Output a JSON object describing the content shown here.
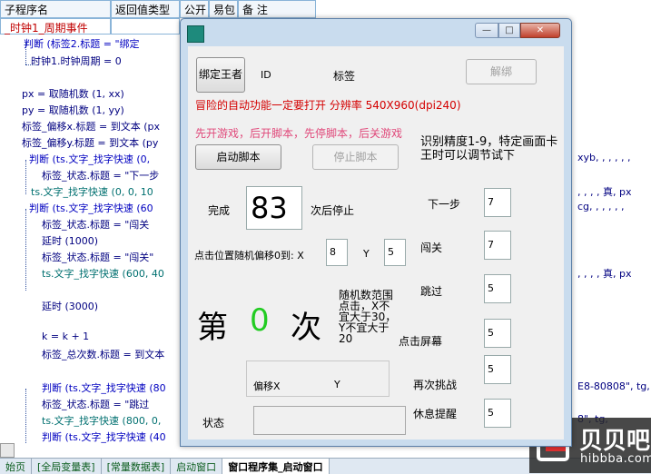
{
  "editor": {
    "headers": [
      "子程序名",
      "返回值类型",
      "公开",
      "易包",
      "备 注"
    ],
    "subroutine_name": "_时钟1_周期事件",
    "lines": [
      "判断 (标签2.标题 = \"绑定",
      "时钟1.时钟周期 = 0",
      "px = 取随机数 (1, xx)",
      "py = 取随机数 (1, yy)",
      "标签_偏移x.标题 = 到文本 (px",
      "标签_偏移y.标题 = 到文本 (py",
      "判断 (ts.文字_找字快速 (0,",
      "标签_状态.标题 = \"下一步",
      "ts.文字_找字快速 (0, 0, 10",
      "判断 (ts.文字_找字快速 (60",
      "标签_状态.标题 = \"闯关",
      "延时 (1000)",
      "标签_状态.标题 = \"闯关\"",
      "ts.文字_找字快速 (600, 40",
      "延时 (3000)",
      "k = k + 1",
      "标签_总次数.标题 = 到文本",
      "判断 (ts.文字_找字快速 (80",
      "标签_状态.标题 = \"跳过",
      "ts.文字_找字快速 (800, 0,",
      "判断 (ts.文字_找字快速 (40"
    ],
    "right_fragments": [
      "xyb, , , , , ,",
      ", , , , 真, px",
      "cg, , , , , ,",
      ", , , , 真, px",
      "E8-80808\", tg,",
      "8\", tg,"
    ],
    "tabs": [
      "始页",
      "[全局变量表]",
      "[常量数据表]",
      "启动窗口",
      "窗口程序集_启动窗口"
    ]
  },
  "watermark": {
    "brand": "贝贝吧",
    "url": "hibbba.com"
  },
  "window": {
    "controls": {
      "min": "—",
      "max": "□",
      "close": "✕"
    },
    "bind_button": "绑定王者",
    "id_label": "ID",
    "tag_label": "标签",
    "unbind_button": "解绑",
    "warning": "冒险的自动功能一定要打开 分辨率 540X960(dpi240)",
    "hint": "先开游戏，后开脚本，先停脚本，后关游戏",
    "precision_text": "识别精度1-9，特定画面卡王时可以调节试下",
    "start_button": "启动脚本",
    "stop_button": "停止脚本",
    "complete_label": "完成",
    "complete_count": "83",
    "stop_after": "次后停止",
    "offset_label": "点击位置随机偏移0到: X",
    "offset_x": "8",
    "y_label": "Y",
    "offset_y": "5",
    "counter_prefix": "第",
    "counter_value": "0",
    "counter_suffix": "次",
    "random_note": "随机数范围点击，X不宜大于30，Y不宜大于20",
    "click_screen": "点击屏幕",
    "offset_x_label": "偏移X",
    "offset_y_label": "Y",
    "status_label": "状态",
    "status_value": "",
    "settings": [
      {
        "label": "下一步",
        "value": "7"
      },
      {
        "label": "闯关",
        "value": "7"
      },
      {
        "label": "跳过",
        "value": "5"
      },
      {
        "label": "点击屏幕",
        "value": "5"
      },
      {
        "label": "再次挑战",
        "value": "5"
      },
      {
        "label": "休息提醒",
        "value": "5"
      }
    ]
  },
  "colors": {
    "warning": "#d40000",
    "hint": "#e0487a",
    "counter": "#22cc22"
  }
}
